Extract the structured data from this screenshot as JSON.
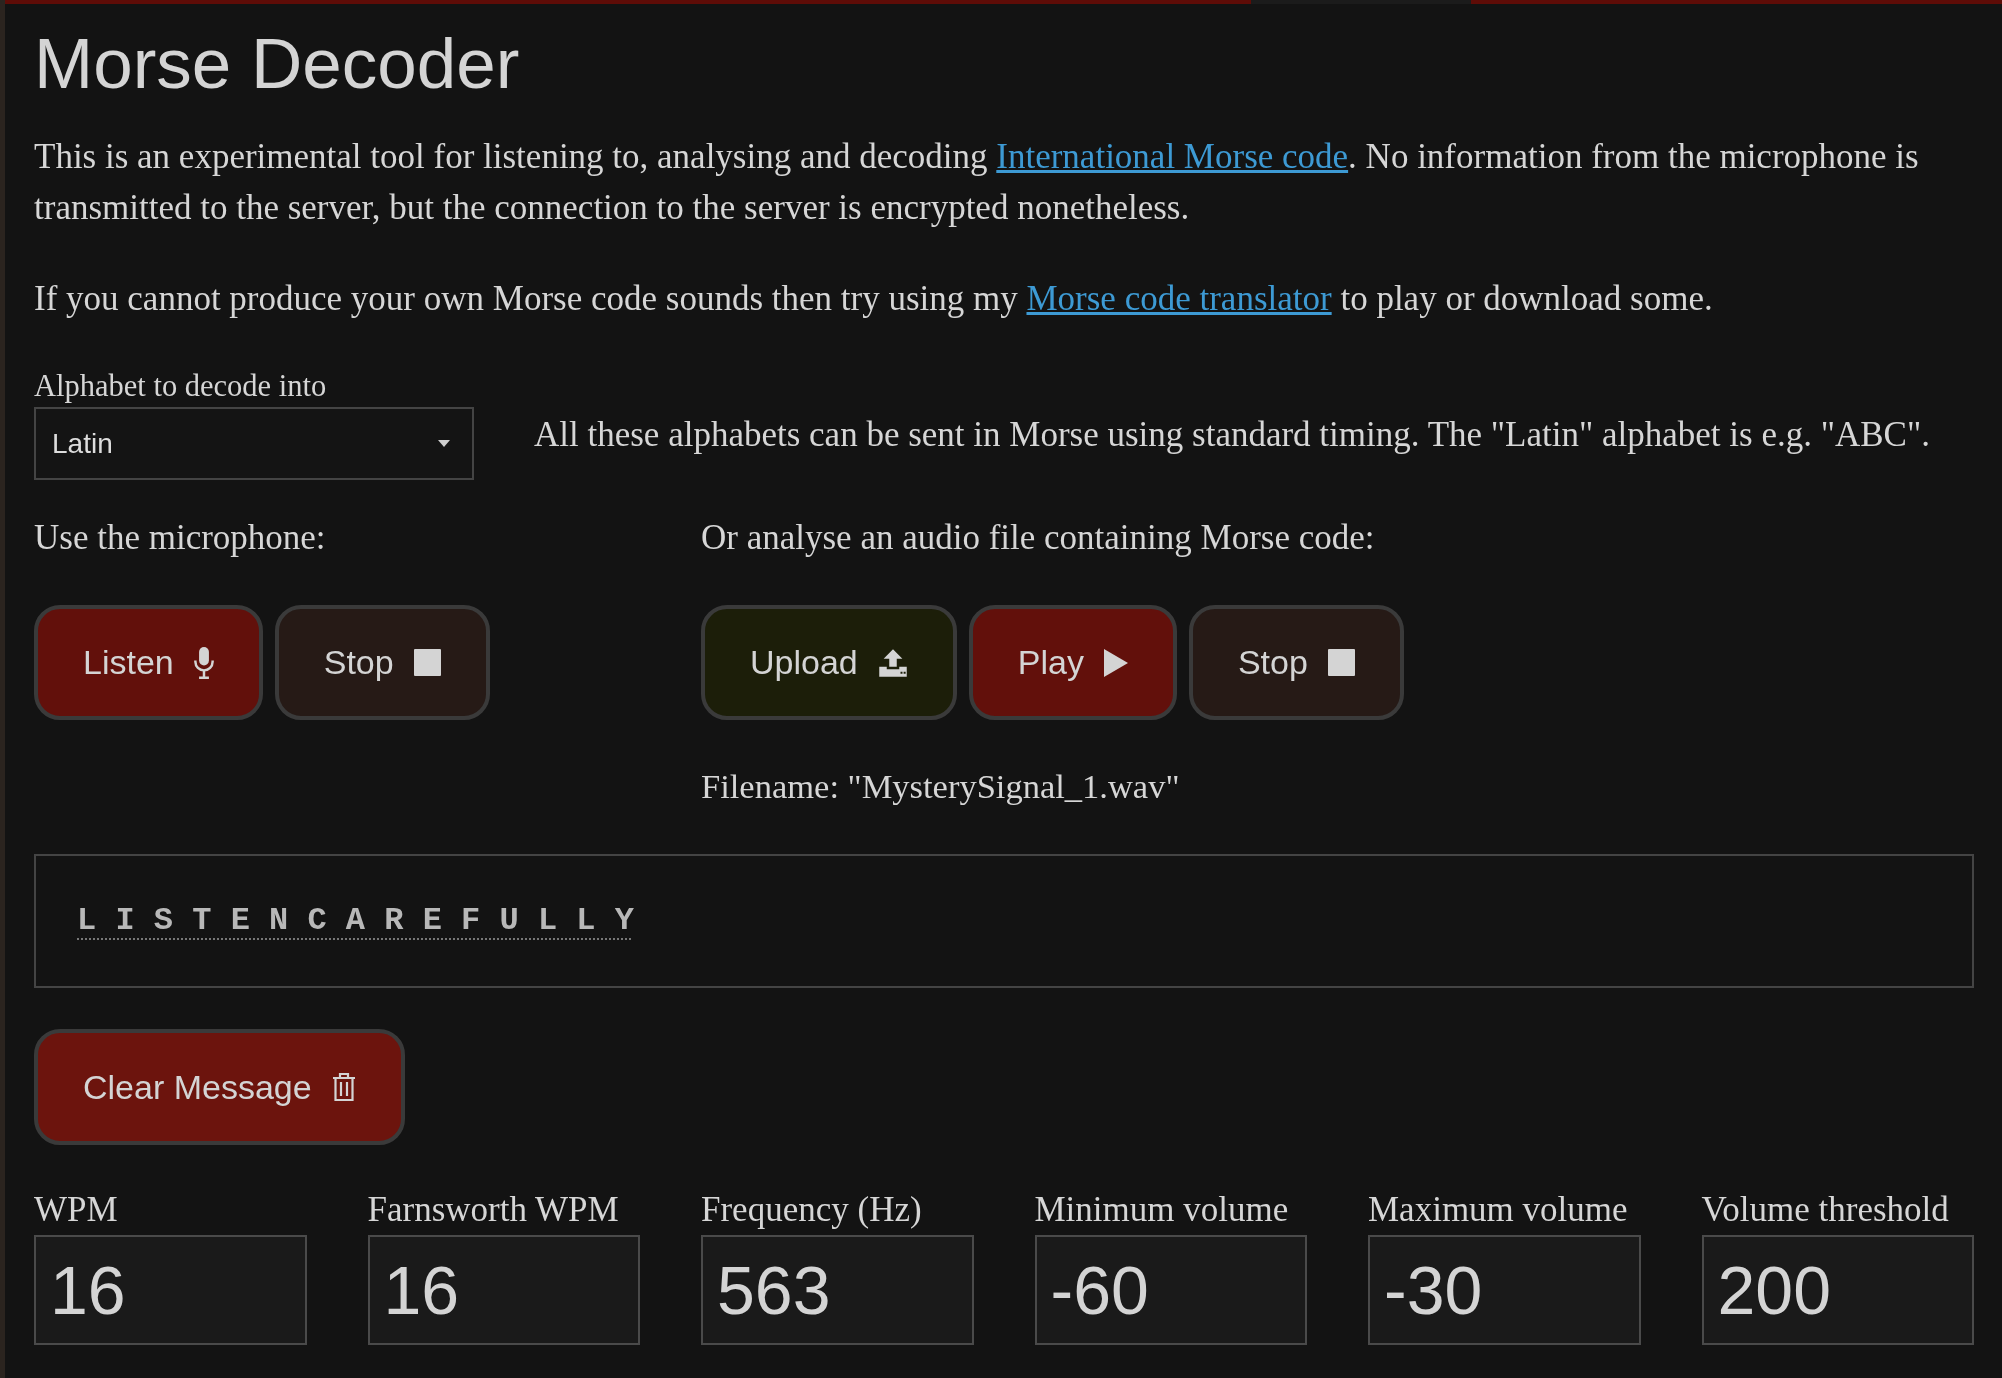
{
  "title": "Morse Decoder",
  "paragraphs": [
    [
      {
        "kind": "text",
        "text": "This is an experimental tool for listening to, analysing and decoding "
      },
      {
        "kind": "link",
        "text": "International Morse code"
      },
      {
        "kind": "text",
        "text": ". No information from the microphone is transmitted to the server, but the connection to the server is encrypted nonetheless."
      }
    ],
    [
      {
        "kind": "text",
        "text": "If you cannot produce your own Morse code sounds then try using my "
      },
      {
        "kind": "link",
        "text": "Morse code translator"
      },
      {
        "kind": "text",
        "text": " to play or download some."
      }
    ]
  ],
  "alphabet": {
    "label": "Alphabet to decode into",
    "value": "Latin",
    "note": "All these alphabets can be sent in Morse using standard timing. The \"Latin\" alphabet is e.g. \"ABC\"."
  },
  "sources": [
    {
      "label": "Use the microphone:",
      "buttons": [
        {
          "kind": "listen",
          "label": "Listen"
        },
        {
          "kind": "stop",
          "label": "Stop"
        }
      ]
    },
    {
      "label": "Or analyse an audio file containing Morse code:",
      "buttons": [
        {
          "kind": "upload",
          "label": "Upload"
        },
        {
          "kind": "play",
          "label": "Play"
        },
        {
          "kind": "stop",
          "label": "Stop"
        }
      ],
      "filename": "Filename: \"MysterySignal_1.wav\""
    }
  ],
  "message": {
    "text": "L I S T E N C A R E F U L L Y"
  },
  "clear_button": {
    "kind": "clear",
    "label": "Clear Message"
  },
  "settings": [
    {
      "label": "WPM",
      "value": "16"
    },
    {
      "label": "Farnsworth WPM",
      "value": "16"
    },
    {
      "label": "Frequency (Hz)",
      "value": "563"
    },
    {
      "label": "Minimum volume",
      "value": "-60"
    },
    {
      "label": "Maximum volume",
      "value": "-30"
    },
    {
      "label": "Volume threshold",
      "value": "200"
    }
  ]
}
